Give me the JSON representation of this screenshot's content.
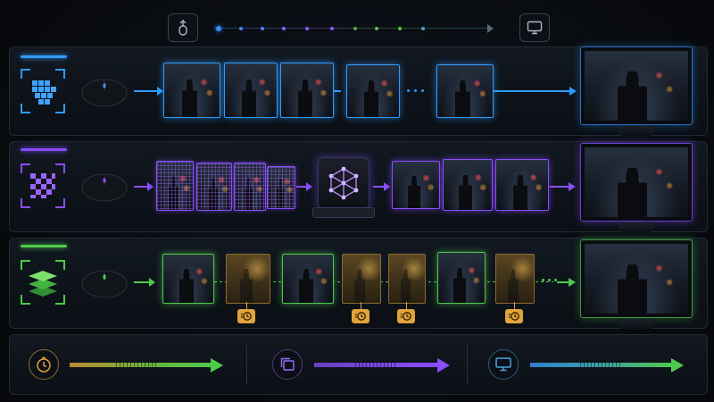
{
  "top": {
    "input_icon": "mouse-input-icon",
    "display_icon": "monitor-icon",
    "dot_colors": [
      "#3b8cff",
      "#3b8cff",
      "#5a7cff",
      "#7a68ff",
      "#8a5cff",
      "#8a5cff",
      "#6aa04f",
      "#57c04a",
      "#57c04a",
      "#3fa0c8"
    ]
  },
  "rows": [
    {
      "name": "traditional",
      "accent": "#2f9bff",
      "icon": "cube-blocks-icon",
      "frames": 5,
      "ellipsis": true
    },
    {
      "name": "ai-upscaling",
      "accent": "#8a4dff",
      "icon": "checker-grid-icon",
      "low_res_frames": 4,
      "processor_icon": "neural-network-icon",
      "frames": 3
    },
    {
      "name": "frame-generation",
      "accent": "#4ec94a",
      "icon": "stacked-layers-icon",
      "frame_pattern": [
        "rendered",
        "generated",
        "rendered",
        "generated",
        "generated",
        "rendered",
        "generated"
      ],
      "generated_badge_icon": "timer-icon",
      "ellipsis": true
    }
  ],
  "summary": [
    {
      "icon": "speed-clock-icon",
      "color_from": "#c98a2b",
      "color_to": "#4ec94a"
    },
    {
      "icon": "layered-frames-icon",
      "color_from": "#7a4dd8",
      "color_to": "#8a4dff"
    },
    {
      "icon": "monitor-icon",
      "color_from": "#2f7fd0",
      "color_to": "#4ec94a"
    }
  ]
}
